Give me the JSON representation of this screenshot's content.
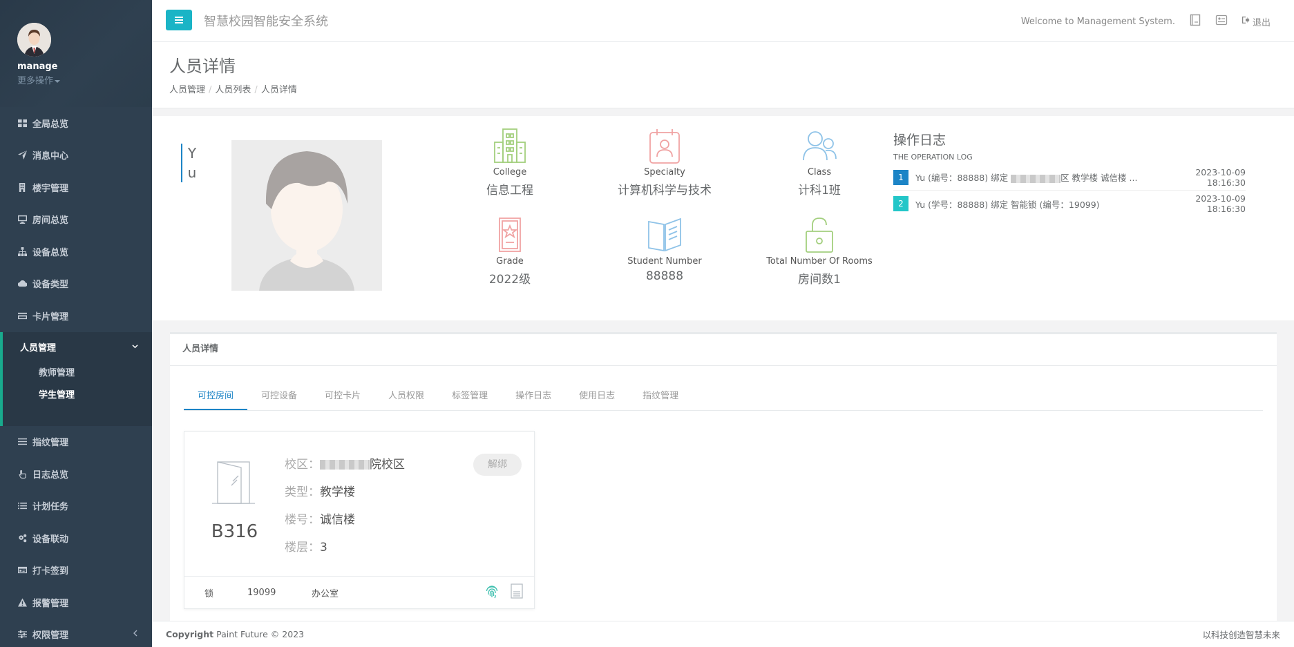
{
  "sidebar": {
    "username": "manage",
    "more_actions": "更多操作",
    "menu": [
      {
        "label": "全局总览",
        "icon": "grid-icon"
      },
      {
        "label": "消息中心",
        "icon": "paper-plane-icon"
      },
      {
        "label": "楼宇管理",
        "icon": "building-icon"
      },
      {
        "label": "房间总览",
        "icon": "monitor-icon"
      },
      {
        "label": "设备总览",
        "icon": "sitemap-icon"
      },
      {
        "label": "设备类型",
        "icon": "cloud-download-icon"
      },
      {
        "label": "卡片管理",
        "icon": "credit-card-icon"
      }
    ],
    "active": {
      "label": "人员管理",
      "icon": "users-icon",
      "sub": [
        "教师管理",
        "学生管理"
      ]
    },
    "menu_after": [
      {
        "label": "指纹管理",
        "icon": "list-icon"
      },
      {
        "label": "日志总览",
        "icon": "hand-pointer-icon"
      },
      {
        "label": "计划任务",
        "icon": "tasks-icon"
      },
      {
        "label": "设备联动",
        "icon": "gears-icon"
      },
      {
        "label": "打卡签到",
        "icon": "id-card-icon"
      },
      {
        "label": "报警管理",
        "icon": "warning-icon"
      },
      {
        "label": "权限管理",
        "icon": "sliders-icon"
      }
    ]
  },
  "topbar": {
    "system_title": "智慧校园智能安全系统",
    "welcome": "Welcome to Management System.",
    "logout": "退出"
  },
  "page": {
    "title": "人员详情",
    "breadcrumb": [
      "人员管理",
      "人员列表",
      "人员详情"
    ]
  },
  "person": {
    "name_chars": [
      "Y",
      "u"
    ],
    "stats": [
      {
        "label": "College",
        "value": "信息工程",
        "color": "#a3cf7e"
      },
      {
        "label": "Specialty",
        "value": "计算机科学与技术",
        "color": "#f0a3a3"
      },
      {
        "label": "Class",
        "value": "计科1班",
        "color": "#8fc3e8"
      },
      {
        "label": "Grade",
        "value": "2022级",
        "color": "#f0a3a3"
      },
      {
        "label": "Student Number",
        "value": "88888",
        "color": "#8fc3e8"
      },
      {
        "label": "Total Number Of Rooms",
        "value": "房间数1",
        "color": "#a3cf7e"
      }
    ]
  },
  "oplog": {
    "title": "操作日志",
    "subtitle": "THE OPERATION LOG",
    "rows": [
      {
        "num": "1",
        "pre": "Yu (编号：88888) 绑定",
        "post": "区 教学楼 诚信楼 ...",
        "time": "2023-10-09 18:16:30",
        "color": "#1c84c6"
      },
      {
        "num": "2",
        "pre": "Yu (学号：88888) 绑定 智能锁 (编号：19099)",
        "post": "",
        "time": "2023-10-09 18:16:30",
        "color": "#23c6c8"
      }
    ]
  },
  "detail": {
    "title": "人员详情",
    "tabs": [
      "可控房间",
      "可控设备",
      "可控卡片",
      "人员权限",
      "标签管理",
      "操作日志",
      "使用日志",
      "指纹管理"
    ],
    "room": {
      "name": "B316",
      "campus_key": "校区：",
      "campus_val": "院校区",
      "type_key": "类型：",
      "type_val": "教学楼",
      "building_key": "楼号：",
      "building_val": "诚信楼",
      "floor_key": "楼层：",
      "floor_val": "3",
      "unbind": "解绑",
      "foot": {
        "lock": "锁",
        "lock_id": "19099",
        "room_type": "办公室"
      }
    }
  },
  "footer": {
    "copyright_bold": "Copyright",
    "copyright": "Paint Future © 2023",
    "slogan": "以科技创造智慧未来"
  }
}
